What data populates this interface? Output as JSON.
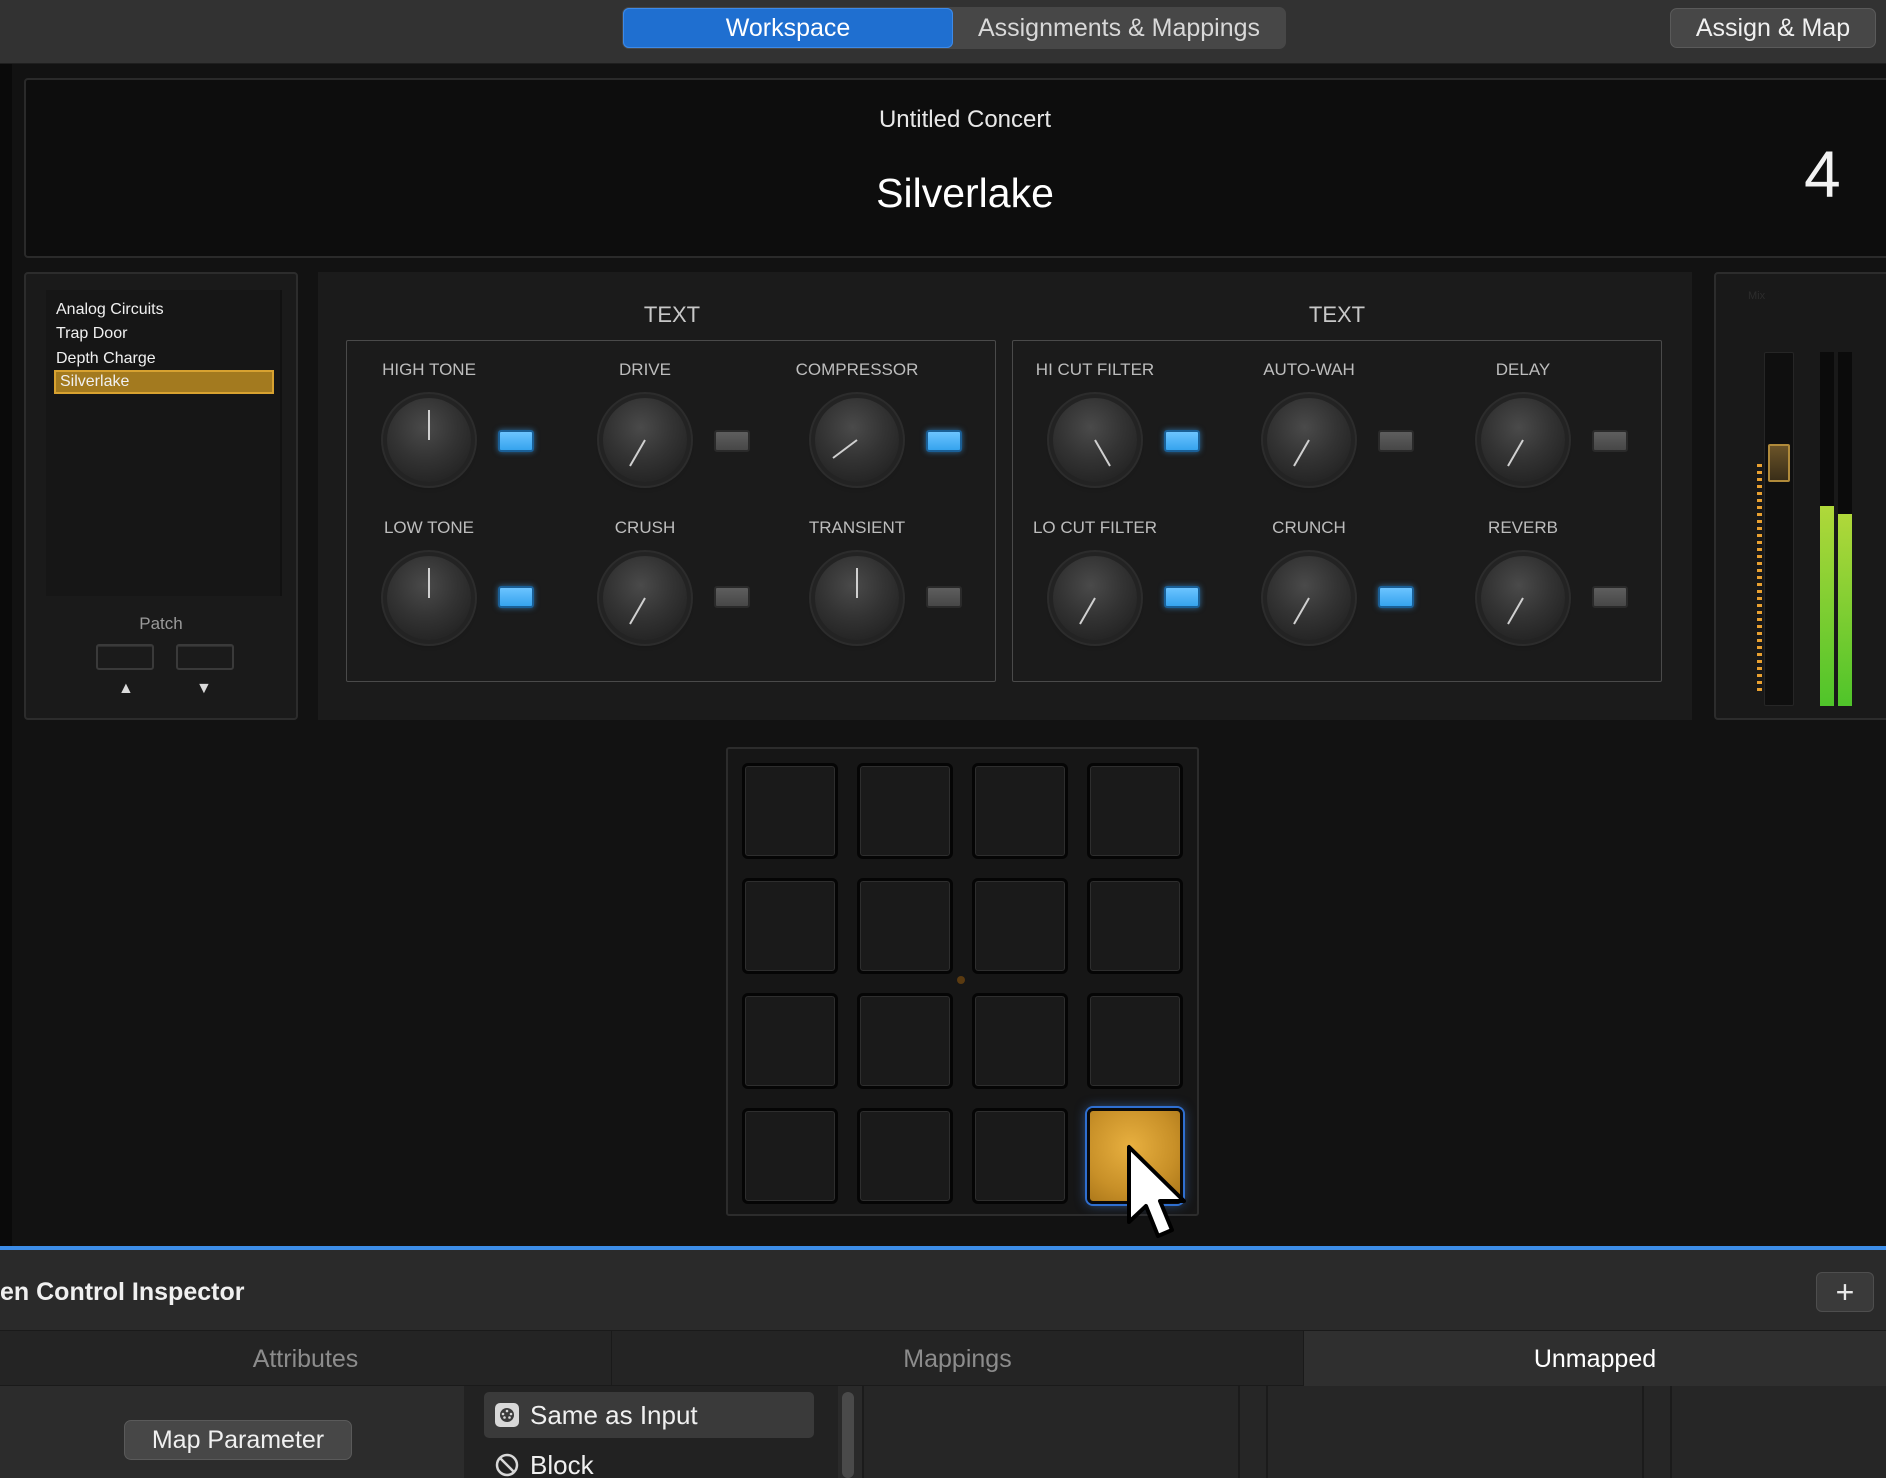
{
  "toolbar": {
    "tabs": [
      {
        "label": "Workspace",
        "active": true
      },
      {
        "label": "Assignments & Mappings",
        "active": false
      }
    ],
    "assign_map_label": "Assign & Map",
    "accent_color": "#1f6fd0"
  },
  "header": {
    "concert_name": "Untitled Concert",
    "patch_name": "Silverlake",
    "patch_number": "4"
  },
  "patch_list": {
    "items": [
      {
        "label": "Analog Circuits",
        "selected": false
      },
      {
        "label": "Trap Door",
        "selected": false
      },
      {
        "label": "Depth Charge",
        "selected": false
      },
      {
        "label": "Silverlake",
        "selected": true
      }
    ],
    "label": "Patch",
    "up_arrow": "▲",
    "down_arrow": "▼"
  },
  "smart_controls": {
    "groups": [
      {
        "title": "TEXT",
        "knobs": [
          {
            "label": "HIGH TONE",
            "led_on": true
          },
          {
            "label": "DRIVE",
            "led_on": false
          },
          {
            "label": "COMPRESSOR",
            "led_on": true
          },
          {
            "label": "LOW TONE",
            "led_on": true
          },
          {
            "label": "CRUSH",
            "led_on": false
          },
          {
            "label": "TRANSIENT",
            "led_on": false
          }
        ]
      },
      {
        "title": "TEXT",
        "knobs": [
          {
            "label": "HI CUT FILTER",
            "led_on": true
          },
          {
            "label": "AUTO-WAH",
            "led_on": false
          },
          {
            "label": "DELAY",
            "led_on": false
          },
          {
            "label": "LO CUT FILTER",
            "led_on": true
          },
          {
            "label": "CRUNCH",
            "led_on": true
          },
          {
            "label": "REVERB",
            "led_on": false
          }
        ]
      }
    ]
  },
  "mixer": {
    "label": "Mix"
  },
  "pads": {
    "rows": 4,
    "cols": 4,
    "active_index": 15,
    "active_color": "#e8b040"
  },
  "inspector": {
    "title": "en Control Inspector",
    "plus_label": "+",
    "tabs": [
      {
        "label": "Attributes",
        "active": false
      },
      {
        "label": "Mappings",
        "active": false
      },
      {
        "label": "Unmapped",
        "active": true
      }
    ],
    "map_parameter_label": "Map Parameter",
    "options": [
      {
        "label": "Same as Input",
        "icon": "midi-port-icon",
        "selected": true
      },
      {
        "label": "Block",
        "icon": "block-icon",
        "selected": false
      }
    ]
  }
}
